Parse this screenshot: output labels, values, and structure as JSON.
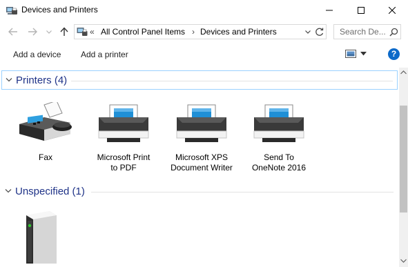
{
  "window": {
    "title": "Devices and Printers",
    "icon": "devices-printers-icon",
    "controls": [
      "minimize-icon",
      "maximize-icon",
      "close-icon"
    ]
  },
  "address": {
    "overflow": "«",
    "crumbs": [
      "All Control Panel Items",
      "Devices and Printers"
    ],
    "search_placeholder": "Search De..."
  },
  "toolbar": {
    "add_device": "Add a device",
    "add_printer": "Add a printer",
    "help": "?"
  },
  "groups": [
    {
      "title": "Printers (4)",
      "devices": [
        {
          "line1": "Fax",
          "line2": "",
          "icon": "fax-icon"
        },
        {
          "line1": "Microsoft Print",
          "line2": "to PDF",
          "icon": "printer-icon"
        },
        {
          "line1": "Microsoft XPS",
          "line2": "Document Writer",
          "icon": "printer-icon"
        },
        {
          "line1": "Send To",
          "line2": "OneNote 2016",
          "icon": "printer-icon"
        }
      ]
    },
    {
      "title": "Unspecified (1)",
      "devices": [
        {
          "line1": "",
          "line2": "",
          "icon": "computer-tower-icon"
        }
      ]
    }
  ],
  "colors": {
    "group_title": "#1e3287",
    "selection_border": "#99d1ff",
    "help_blue": "#0c6ac9",
    "printer_screen": "#1f8fd6"
  }
}
